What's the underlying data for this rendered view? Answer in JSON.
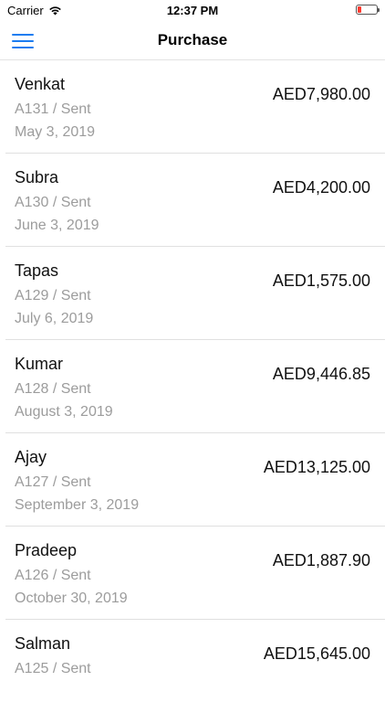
{
  "status": {
    "carrier": "Carrier",
    "time": "12:37 PM"
  },
  "nav": {
    "title": "Purchase"
  },
  "colors": {
    "accent": "#1b7cf0",
    "secondary_text": "#9c9c9c",
    "battery_low": "#ff3b30"
  },
  "purchases": [
    {
      "name": "Venkat",
      "sub": "A131 / Sent",
      "date": "May 3, 2019",
      "amount": "AED7,980.00"
    },
    {
      "name": "Subra",
      "sub": "A130 / Sent",
      "date": "June 3, 2019",
      "amount": "AED4,200.00"
    },
    {
      "name": "Tapas",
      "sub": "A129 / Sent",
      "date": "July 6, 2019",
      "amount": "AED1,575.00"
    },
    {
      "name": "Kumar",
      "sub": "A128 / Sent",
      "date": "August 3, 2019",
      "amount": "AED9,446.85"
    },
    {
      "name": "Ajay",
      "sub": "A127 / Sent",
      "date": "September 3, 2019",
      "amount": "AED13,125.00"
    },
    {
      "name": "Pradeep",
      "sub": "A126 / Sent",
      "date": "October 30, 2019",
      "amount": "AED1,887.90"
    },
    {
      "name": "Salman",
      "sub": "A125 / Sent",
      "date": "",
      "amount": "AED15,645.00"
    }
  ]
}
